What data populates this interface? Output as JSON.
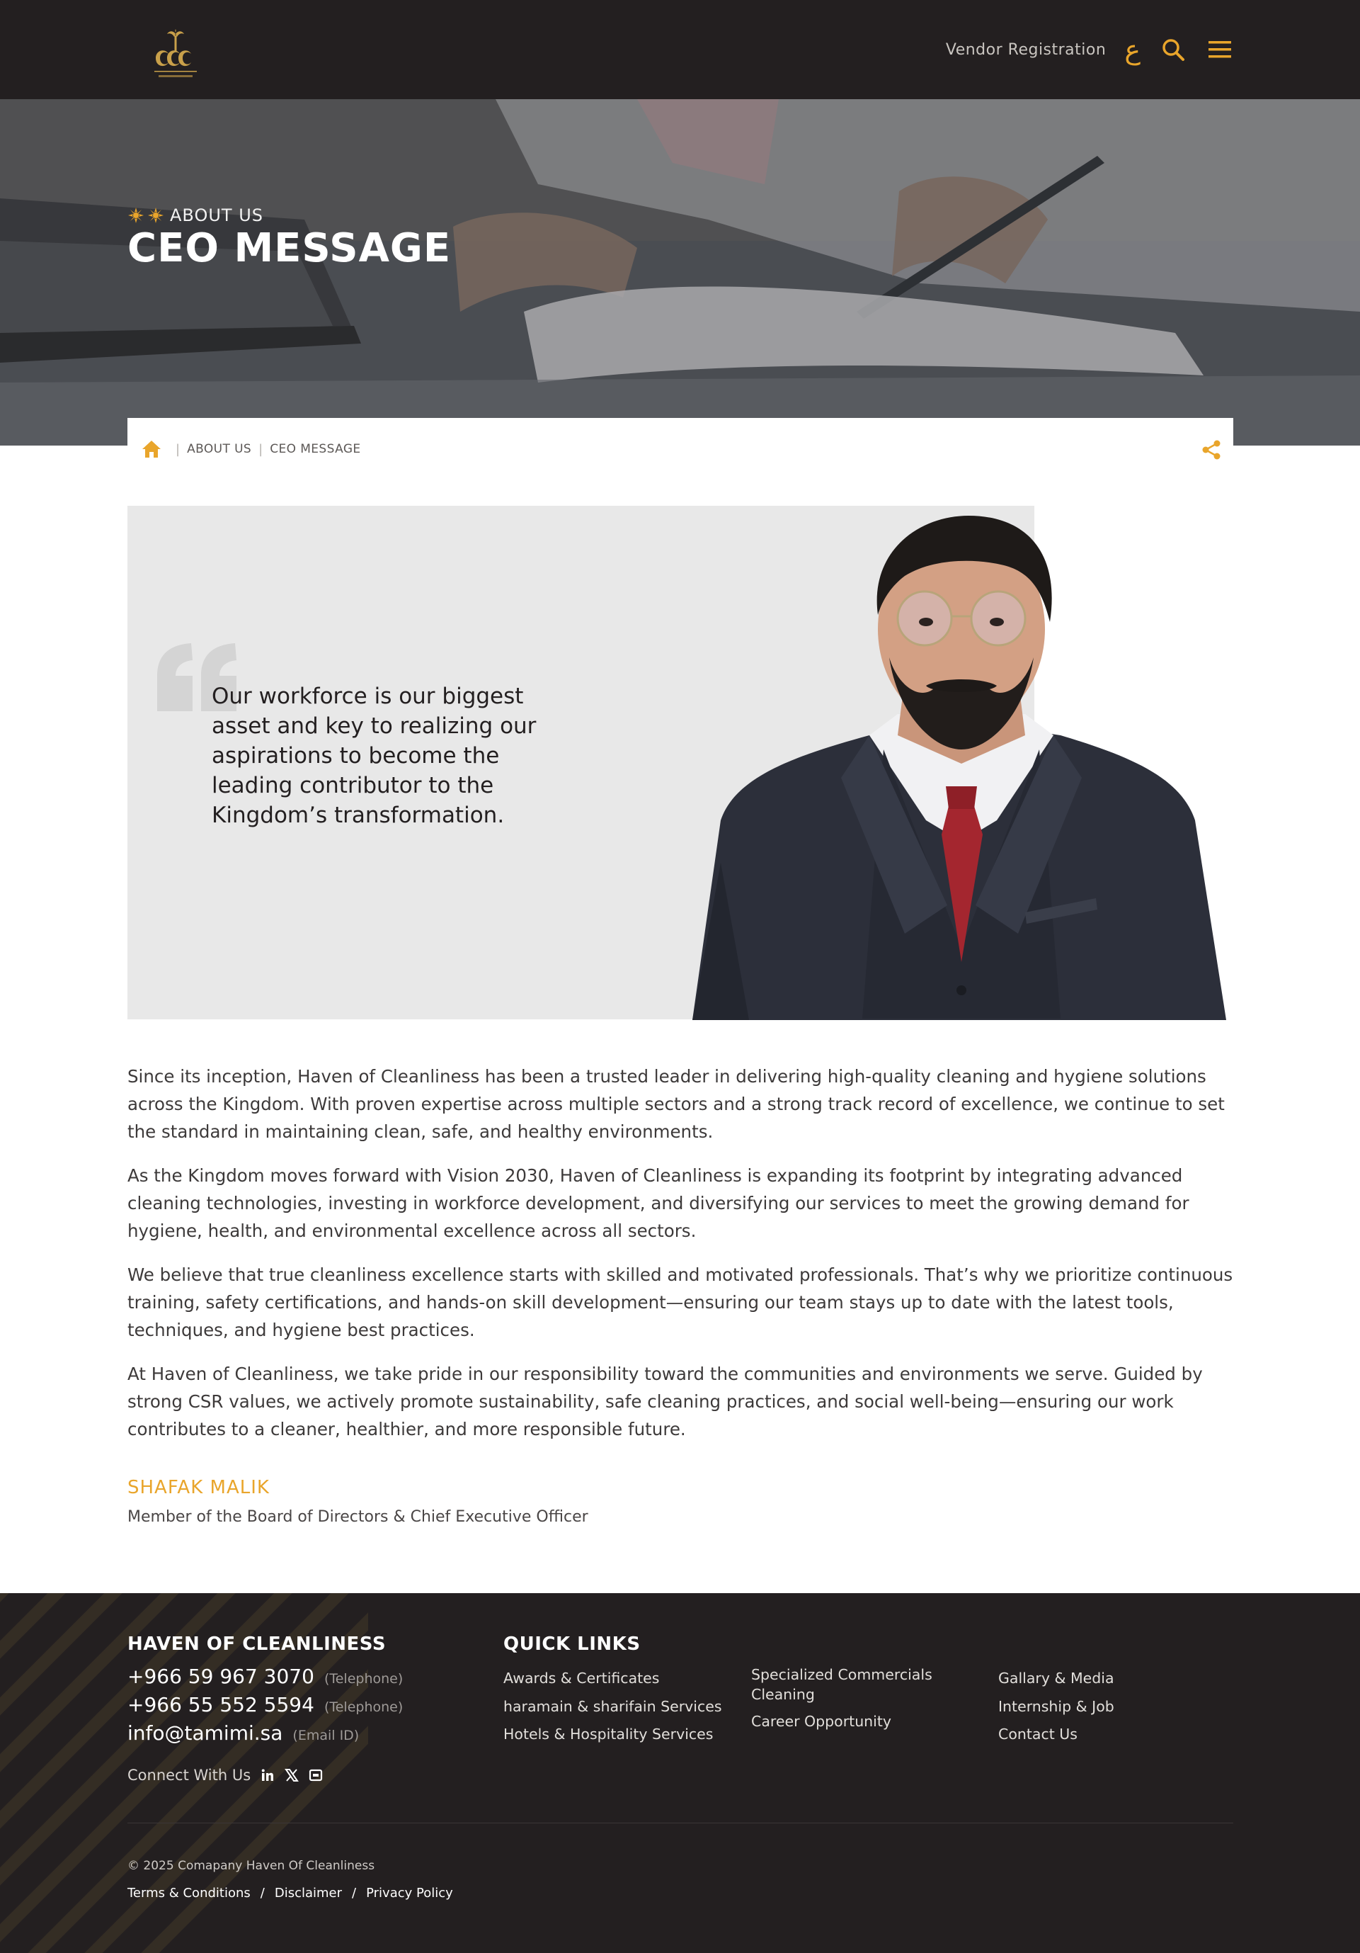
{
  "header": {
    "vendor_label": "Vendor Registration",
    "lang_label": "ع",
    "search_icon": "search-icon",
    "menu_icon": "hamburger-menu-icon",
    "accent_color": "#e9a52b"
  },
  "hero": {
    "eyebrow": "ABOUT US",
    "title": "CEO MESSAGE"
  },
  "breadcrumb": {
    "items": [
      "ABOUT US",
      "CEO MESSAGE"
    ],
    "home_icon": "home-icon",
    "share_icon": "share-icon"
  },
  "quote": {
    "text": "Our workforce is our biggest asset and key to realizing our aspirations to become the leading contributor to the Kingdom’s transformation."
  },
  "body": {
    "paragraphs": [
      "Since its inception, Haven of Cleanliness has been a trusted leader in delivering high-quality cleaning and hygiene solutions across the Kingdom. With proven expertise across multiple sectors and a strong track record of excellence, we continue to set the standard in maintaining clean, safe, and healthy environments.",
      "As the Kingdom moves forward with Vision 2030, Haven of Cleanliness is expanding its footprint by integrating advanced cleaning technologies, investing in workforce development, and diversifying our services to meet the growing demand for hygiene, health, and environmental excellence across all sectors.",
      "We believe that true cleanliness excellence starts with skilled and motivated professionals. That’s why we prioritize continuous training, safety certifications, and hands-on skill development—ensuring our team stays up to date with the latest tools, techniques, and hygiene best practices.",
      "At Haven of Cleanliness, we take pride in our responsibility toward the communities and environments we serve. Guided by strong CSR values, we actively promote sustainability, safe cleaning practices, and social well-being—ensuring our work contributes to a cleaner, healthier, and more responsible future."
    ],
    "signer_name": "SHAFAK MALIK",
    "signer_role": "Member of the Board of Directors & Chief Executive Officer"
  },
  "footer": {
    "company_title": "HAVEN OF CLEANLINESS",
    "contacts": [
      {
        "value": "+966 59 967 3070",
        "type": "(Telephone)"
      },
      {
        "value": "+966 55 552 5594",
        "type": "(Telephone)"
      },
      {
        "value": "info@tamimi.sa",
        "type": "(Email ID)"
      }
    ],
    "connect_label": "Connect With Us",
    "quick_links_title": "QUICK LINKS",
    "links_col1": [
      "Awards & Certificates",
      "haramain & sharifain Services",
      "Hotels & Hospitality Services"
    ],
    "links_col2": [
      "Specialized Commercials Cleaning",
      "Career Opportunity"
    ],
    "links_col3": [
      "Gallary & Media",
      "Internship & Job",
      "Contact Us"
    ],
    "copyright": "© 2025 Comapany Haven Of Cleanliness",
    "legal": [
      "Terms & Conditions",
      "Disclaimer",
      "Privacy Policy"
    ]
  }
}
